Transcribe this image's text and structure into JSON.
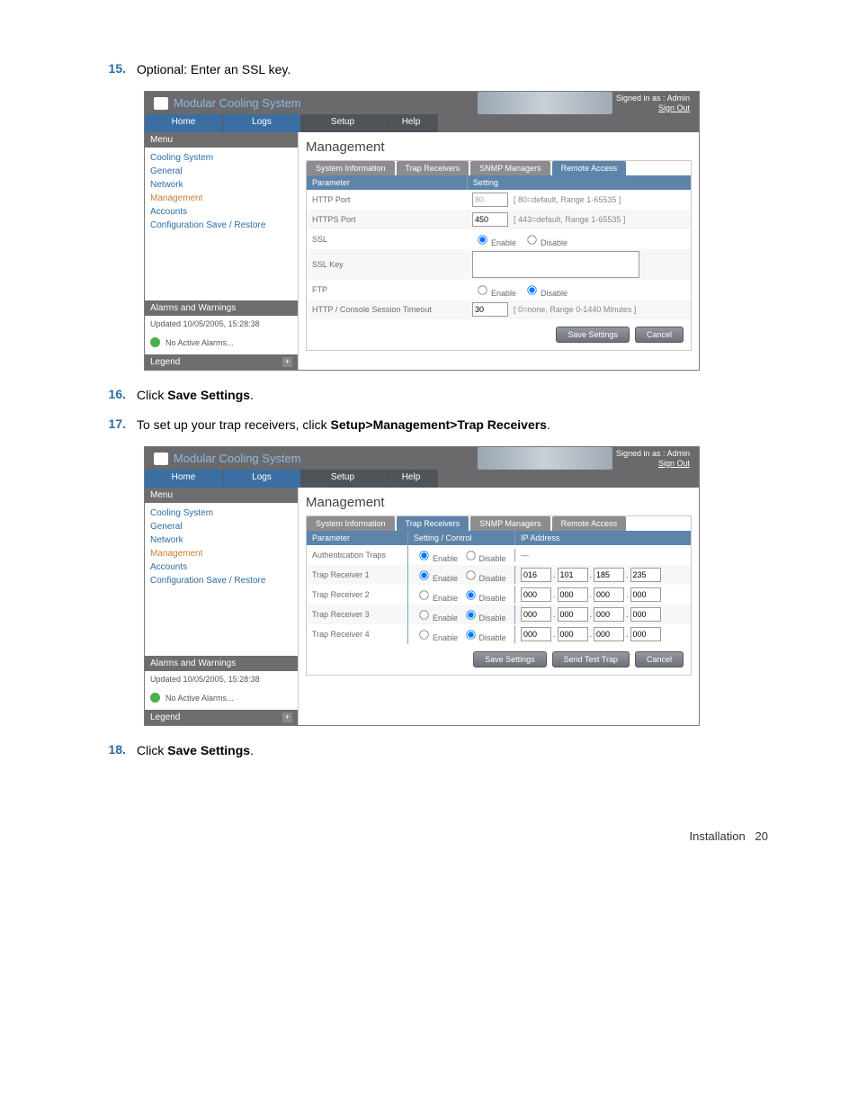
{
  "steps": {
    "s15": {
      "num": "15.",
      "text": "Optional: Enter an SSL key."
    },
    "s16": {
      "num": "16.",
      "prefix": "Click ",
      "bold": "Save Settings",
      "suffix": "."
    },
    "s17": {
      "num": "17.",
      "prefix": "To set up your trap receivers, click ",
      "bold": "Setup>Management>Trap Receivers",
      "suffix": "."
    },
    "s18": {
      "num": "18.",
      "prefix": "Click ",
      "bold": "Save Settings",
      "suffix": "."
    }
  },
  "shared": {
    "product_title": "Modular Cooling System",
    "signed_in": "Signed in as : Admin",
    "sign_out": "Sign Out",
    "nav": {
      "home": "Home",
      "logs": "Logs",
      "setup": "Setup",
      "help": "Help"
    },
    "menu_header": "Menu",
    "menu": [
      "Cooling System",
      "General",
      "Network",
      "Management",
      "Accounts",
      "Configuration Save / Restore"
    ],
    "alarms_header": "Alarms and Warnings",
    "updated": "Updated 10/05/2005, 15:28:38",
    "no_alarms": "No Active Alarms...",
    "legend": "Legend",
    "page_h1": "Management",
    "subtabs": [
      "System Information",
      "Trap Receivers",
      "SNMP Managers",
      "Remote Access"
    ]
  },
  "shot1": {
    "active_subtab": "Remote Access",
    "th": {
      "param": "Parameter",
      "setting": "Setting"
    },
    "rows": {
      "http_port": {
        "label": "HTTP Port",
        "value": "80",
        "hint": "[ 80=default, Range 1-65535 ]"
      },
      "https_port": {
        "label": "HTTPS Port",
        "value": "450",
        "hint": "[ 443=default, Range 1-65535 ]"
      },
      "ssl": {
        "label": "SSL",
        "enable": "Enable",
        "disable": "Disable"
      },
      "ssl_key": {
        "label": "SSL Key"
      },
      "ftp": {
        "label": "FTP",
        "enable": "Enable",
        "disable": "Disable"
      },
      "timeout": {
        "label": "HTTP / Console Session Timeout",
        "value": "30",
        "hint": "[ 0=none, Range 0-1440 Minutes ]"
      }
    },
    "buttons": {
      "save": "Save Settings",
      "cancel": "Cancel"
    }
  },
  "shot2": {
    "active_subtab": "Trap Receivers",
    "th": {
      "param": "Parameter",
      "setting": "Setting / Control",
      "ip": "IP Address"
    },
    "rows": [
      {
        "label": "Authentication Traps",
        "enable": "Enable",
        "disable": "Disable",
        "enabled": true,
        "ip": null
      },
      {
        "label": "Trap Receiver 1",
        "enable": "Enable",
        "disable": "Disable",
        "enabled": true,
        "ip": [
          "016",
          "101",
          "185",
          "235"
        ]
      },
      {
        "label": "Trap Receiver 2",
        "enable": "Enable",
        "disable": "Disable",
        "enabled": false,
        "ip": [
          "000",
          "000",
          "000",
          "000"
        ]
      },
      {
        "label": "Trap Receiver 3",
        "enable": "Enable",
        "disable": "Disable",
        "enabled": false,
        "ip": [
          "000",
          "000",
          "000",
          "000"
        ]
      },
      {
        "label": "Trap Receiver 4",
        "enable": "Enable",
        "disable": "Disable",
        "enabled": false,
        "ip": [
          "000",
          "000",
          "000",
          "000"
        ]
      }
    ],
    "buttons": {
      "save": "Save Settings",
      "send": "Send Test Trap",
      "cancel": "Cancel"
    }
  },
  "footer": {
    "section": "Installation",
    "page": "20"
  }
}
